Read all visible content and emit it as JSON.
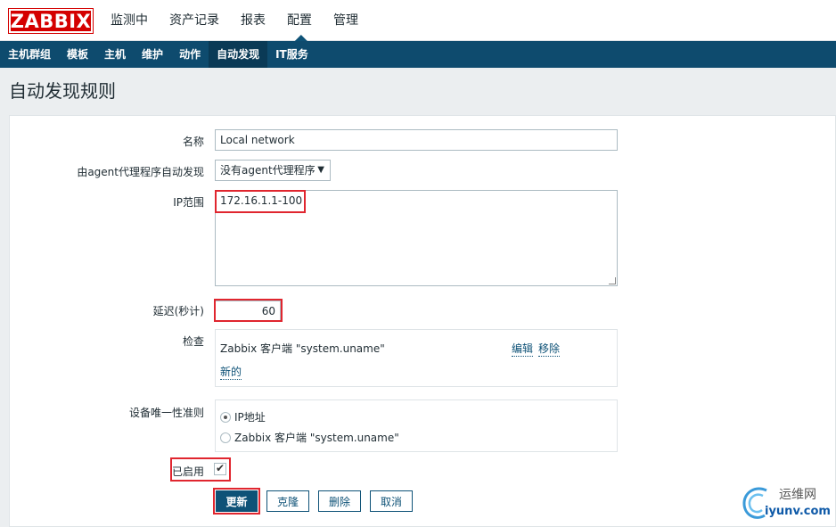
{
  "app": {
    "logo": "ZABBIX"
  },
  "top_nav": [
    "监测中",
    "资产记录",
    "报表",
    "配置",
    "管理"
  ],
  "top_nav_active": "配置",
  "sub_nav": [
    "主机群组",
    "模板",
    "主机",
    "维护",
    "动作",
    "自动发现",
    "IT服务"
  ],
  "sub_nav_active": "自动发现",
  "page_title": "自动发现规则",
  "form": {
    "name_label": "名称",
    "name_value": "Local network",
    "proxy_label": "由agent代理程序自动发现",
    "proxy_value": "没有agent代理程序",
    "ip_range_label": "IP范围",
    "ip_range_value": "172.16.1.1-100",
    "delay_label": "延迟(秒计)",
    "delay_value": "60",
    "checks_label": "检查",
    "checks": [
      {
        "text": "Zabbix 客户端 \"system.uname\"",
        "edit": "编辑",
        "remove": "移除"
      }
    ],
    "new_check": "新的",
    "uniqueness_label": "设备唯一性准则",
    "uniqueness_options": [
      {
        "text": "IP地址",
        "selected": true
      },
      {
        "text": "Zabbix 客户端 \"system.uname\"",
        "selected": false
      }
    ],
    "enabled_label": "已启用",
    "enabled": true
  },
  "buttons": {
    "update": "更新",
    "clone": "克隆",
    "delete": "删除",
    "cancel": "取消"
  },
  "watermark": {
    "zh": "运维网",
    "en": "iyunv.com"
  },
  "colors": {
    "brand_red": "#d40000",
    "nav_blue": "#0e4b6e",
    "primary": "#0e5277",
    "highlight": "#e0262f"
  }
}
